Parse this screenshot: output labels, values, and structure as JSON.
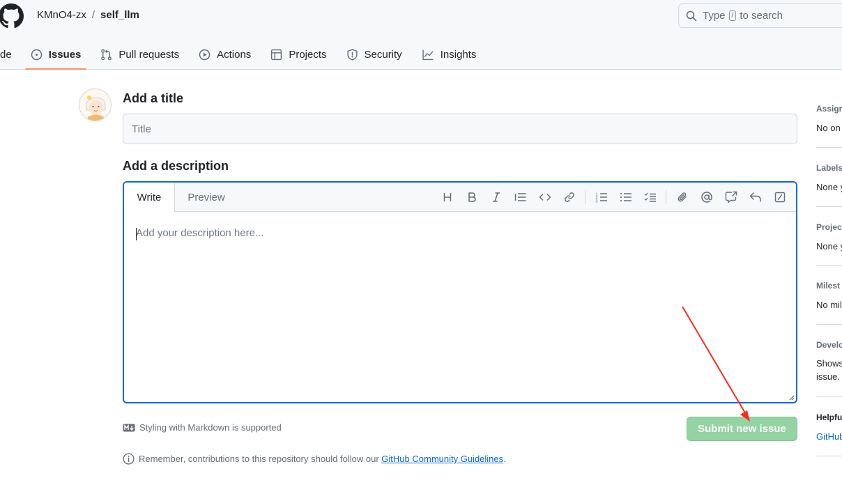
{
  "header": {
    "repo_owner": "KMnO4-zx",
    "separator": "/",
    "repo_name": "self_llm",
    "search_prefix": "Type",
    "search_key": "/",
    "search_suffix": "to search"
  },
  "nav": {
    "items": [
      {
        "label": "de",
        "icon": "code-icon"
      },
      {
        "label": "Issues",
        "icon": "issue-opened-icon",
        "selected": true
      },
      {
        "label": "Pull requests",
        "icon": "git-pull-request-icon"
      },
      {
        "label": "Actions",
        "icon": "play-icon"
      },
      {
        "label": "Projects",
        "icon": "table-icon"
      },
      {
        "label": "Security",
        "icon": "shield-icon"
      },
      {
        "label": "Insights",
        "icon": "graph-icon"
      }
    ]
  },
  "form": {
    "title_heading": "Add a title",
    "title_placeholder": "Title",
    "description_heading": "Add a description",
    "tab_write": "Write",
    "tab_preview": "Preview",
    "description_placeholder": "Add your description here...",
    "markdown_note": "Styling with Markdown is supported",
    "submit_label": "Submit new issue",
    "guidelines_text": "Remember, contributions to this repository should follow our",
    "guidelines_link": "GitHub Community Guidelines",
    "guidelines_end": "."
  },
  "toolbar": {
    "tools": [
      "heading-icon",
      "bold-icon",
      "italic-icon",
      "quote-icon",
      "code-icon",
      "link-icon",
      "ordered-list-icon",
      "unordered-list-icon",
      "task-list-icon",
      "paperclip-icon",
      "mention-icon",
      "cross-reference-icon",
      "reply-icon",
      "slash-command-icon"
    ]
  },
  "sidebar": {
    "assignees_title": "Assign",
    "assignees_value": "No on",
    "labels_title": "Labels",
    "labels_value": "None y",
    "projects_title": "Projec",
    "projects_value": "None y",
    "milestone_title": "Milest",
    "milestone_value": "No mil",
    "development_title": "Develo",
    "development_line1": "Shows",
    "development_line2": "issue.",
    "helpful_title": "Helpfu",
    "helpful_link": "GitHub"
  },
  "colors": {
    "accent_blue": "#0969da",
    "submit_green_disabled": "#94d3a2",
    "nav_underline": "#fd8c73",
    "annotation_red": "#ff2a1a"
  }
}
